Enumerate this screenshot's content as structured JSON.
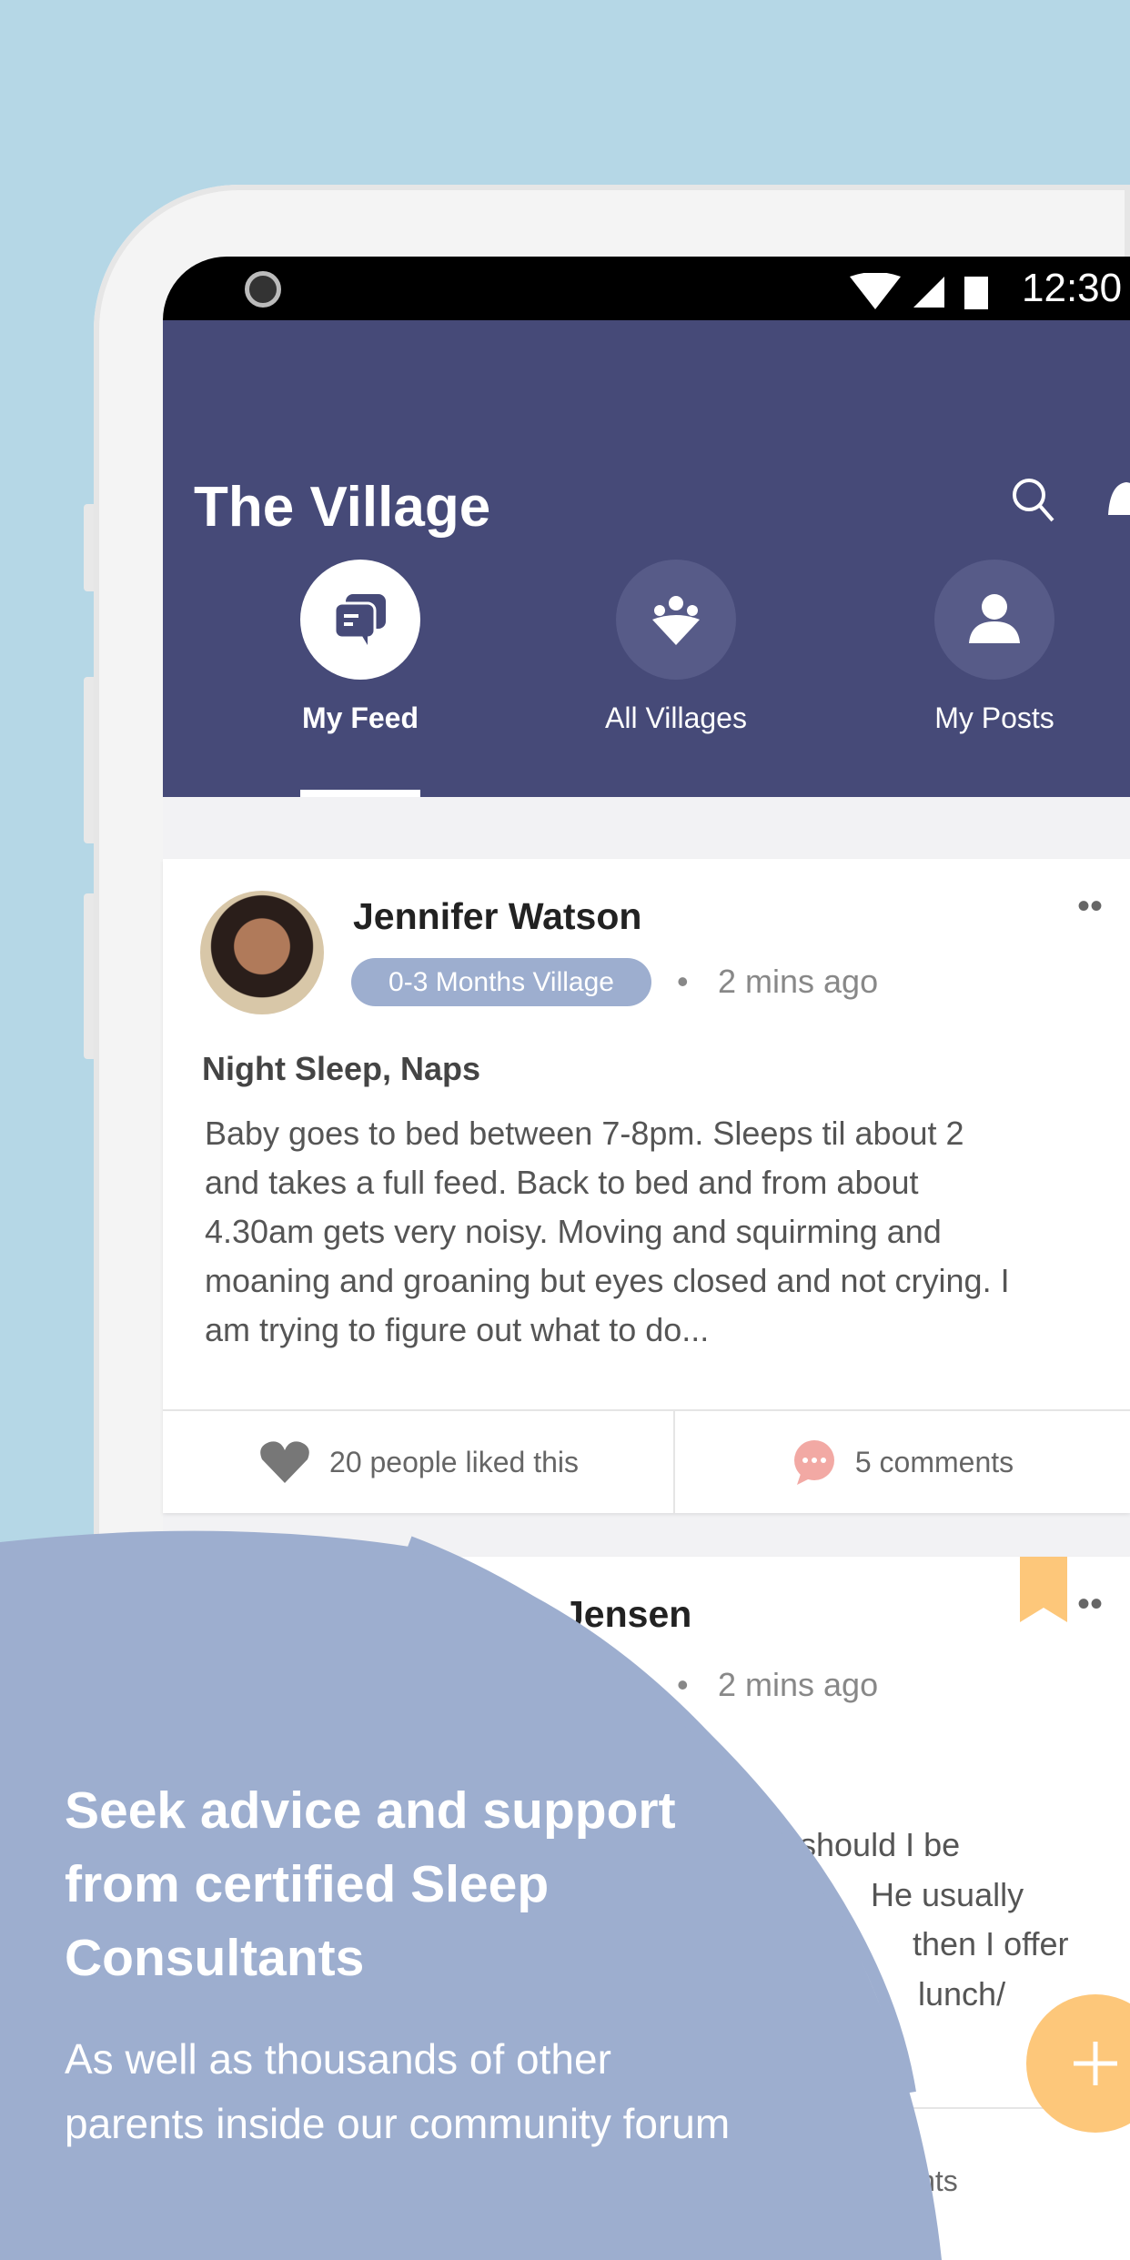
{
  "status": {
    "time": "12:30"
  },
  "app": {
    "title": "The Village"
  },
  "tabs": [
    {
      "label": "My Feed",
      "icon": "chat-bubbles-icon",
      "active": true
    },
    {
      "label": "All Villages",
      "icon": "group-icon"
    },
    {
      "label": "My Posts",
      "icon": "person-icon"
    }
  ],
  "post1": {
    "author": "Jennifer Watson",
    "village": "0-3 Months Village",
    "time": "2 mins ago",
    "topic": "Night Sleep, Naps",
    "lines": [
      "Baby goes to bed between 7-8pm. Sleeps til about 2",
      "and takes a full feed. Back to bed and from about",
      "4.30am gets very noisy. Moving and squirming and",
      "moaning and groaning but eyes closed and not crying. I",
      "am trying to figure out what to do..."
    ],
    "likes": "20 people liked this",
    "comments": "5 comments"
  },
  "post2": {
    "author": "Jensen",
    "time": "2 mins ago",
    "lines": [
      "should I be",
      "He usually",
      "then I offer",
      "lunch/"
    ],
    "comments": "mments"
  },
  "promo": {
    "heading": [
      "Seek advice and support",
      "from certified Sleep",
      "Consultants"
    ],
    "sub": [
      "As well as thousands of other",
      "parents inside our community forum"
    ]
  },
  "colors": {
    "background": "#b5d7e6",
    "header": "#464a78",
    "badge": "#9daecf",
    "fab": "#fdc77a",
    "overlay": "#9daecf"
  }
}
